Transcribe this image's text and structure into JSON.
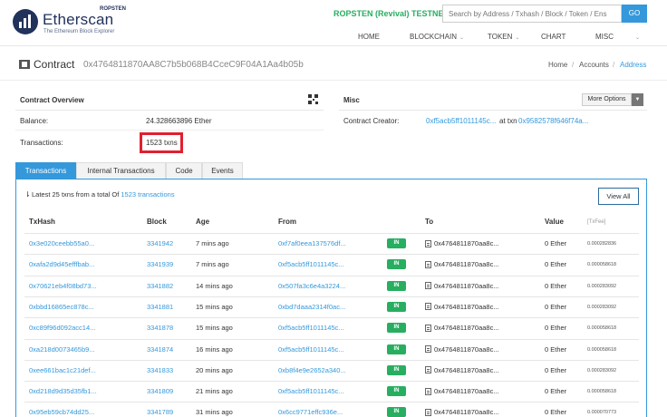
{
  "header": {
    "logo_name": "Etherscan",
    "logo_network": "ROPSTEN",
    "logo_tagline": "The Ethereum Block Explorer",
    "testnet_label": "ROPSTEN (Revival) TESTNET",
    "search_placeholder": "Search by Address / Txhash / Block / Token / Ens",
    "go_label": "GO",
    "nav": [
      "HOME",
      "BLOCKCHAIN",
      "TOKEN",
      "CHART",
      "MISC"
    ]
  },
  "title": {
    "label": "Contract",
    "address": "0x4764811870AA8C7b5b068B4CceC9F04A1Aa4b05b",
    "breadcrumb": [
      "Home",
      "Accounts",
      "Address"
    ]
  },
  "overview": {
    "title": "Contract Overview",
    "balance_label": "Balance:",
    "balance_value": "24.328663896 Ether",
    "tx_label": "Transactions:",
    "tx_value": "1523 txns"
  },
  "misc": {
    "title": "Misc",
    "more_options": "More Options",
    "creator_label": "Contract Creator:",
    "creator_addr": "0xf5acb5ff1011145c...",
    "at_txn": "at txn",
    "creator_tx": "0x9582578f646f74a..."
  },
  "tabs": [
    "Transactions",
    "Internal Transactions",
    "Code",
    "Events"
  ],
  "summary": {
    "prefix": "Latest 25 txns from a total Of",
    "count_link": "1523 transactions"
  },
  "view_all": "View All",
  "columns": [
    "TxHash",
    "Block",
    "Age",
    "From",
    "",
    "To",
    "Value",
    "[TxFee]"
  ],
  "rows": [
    {
      "hash": "0x3e020ceebb55a0...",
      "block": "3341942",
      "age": "7 mins ago",
      "from": "0xf7af0eea137576df...",
      "dir": "IN",
      "to": "0x4764811870aa8c...",
      "value": "0 Ether",
      "fee": "0.000282836"
    },
    {
      "hash": "0xafa2d9d45efffbab...",
      "block": "3341939",
      "age": "7 mins ago",
      "from": "0xf5acb5ff1011145c...",
      "dir": "IN",
      "to": "0x4764811870aa8c...",
      "value": "0 Ether",
      "fee": "0.000058618"
    },
    {
      "hash": "0x70621eb4f08bd73...",
      "block": "3341882",
      "age": "14 mins ago",
      "from": "0x507fa3c6e4a3224...",
      "dir": "IN",
      "to": "0x4764811870aa8c...",
      "value": "0 Ether",
      "fee": "0.000283092"
    },
    {
      "hash": "0xbbd16865ec878c...",
      "block": "3341881",
      "age": "15 mins ago",
      "from": "0xbd7daaa2314f0ac...",
      "dir": "IN",
      "to": "0x4764811870aa8c...",
      "value": "0 Ether",
      "fee": "0.000283092"
    },
    {
      "hash": "0xc89f96d092acc14...",
      "block": "3341878",
      "age": "15 mins ago",
      "from": "0xf5acb5ff1011145c...",
      "dir": "IN",
      "to": "0x4764811870aa8c...",
      "value": "0 Ether",
      "fee": "0.000058618"
    },
    {
      "hash": "0xa218d0073465b9...",
      "block": "3341874",
      "age": "16 mins ago",
      "from": "0xf5acb5ff1011145c...",
      "dir": "IN",
      "to": "0x4764811870aa8c...",
      "value": "0 Ether",
      "fee": "0.000058618"
    },
    {
      "hash": "0xee661bac1c21def...",
      "block": "3341833",
      "age": "20 mins ago",
      "from": "0xb8f4e9e2652a340...",
      "dir": "IN",
      "to": "0x4764811870aa8c...",
      "value": "0 Ether",
      "fee": "0.000283092"
    },
    {
      "hash": "0xd218d9d35d35fb1...",
      "block": "3341809",
      "age": "21 mins ago",
      "from": "0xf5acb5ff1011145c...",
      "dir": "IN",
      "to": "0x4764811870aa8c...",
      "value": "0 Ether",
      "fee": "0.000058618"
    },
    {
      "hash": "0x95eb59cb74dd25...",
      "block": "3341789",
      "age": "31 mins ago",
      "from": "0x6cc9771effc936e...",
      "dir": "IN",
      "to": "0x4764811870aa8c...",
      "value": "0 Ether",
      "fee": "0.000070773"
    }
  ],
  "colors": {
    "accent": "#3498db",
    "in_badge": "#27ae60",
    "highlight": "#e0202f",
    "brand": "#21325b"
  }
}
